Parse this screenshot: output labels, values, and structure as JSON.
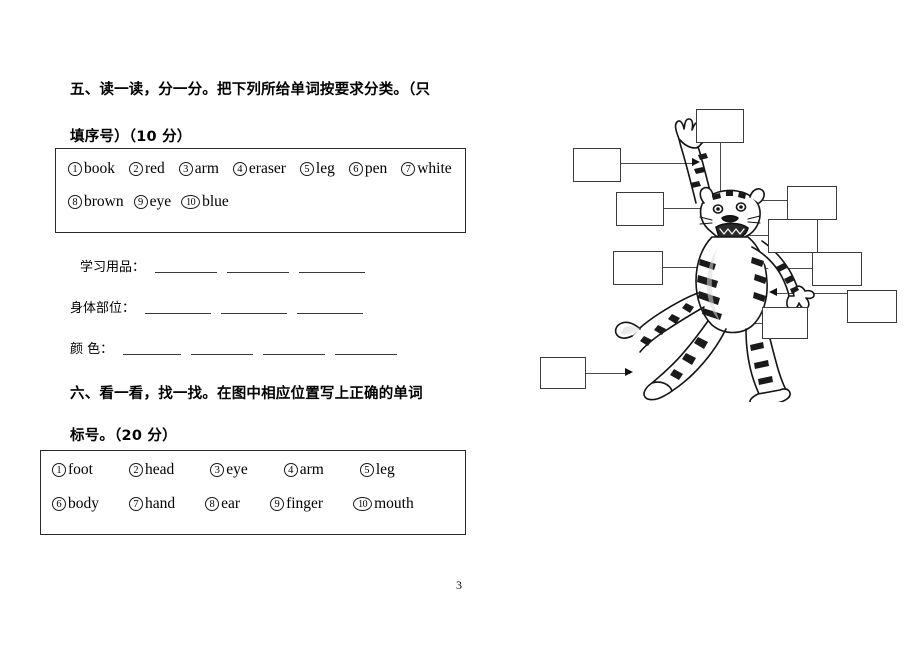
{
  "document": {
    "page_number": "3",
    "background_color": "#ffffff",
    "ink_color": "#000000"
  },
  "section_five": {
    "heading_line1": "五、读一读，分一分。把下列所给单词按要求分类。（只",
    "heading_line2": "填序号）（10 分）",
    "word_bank": {
      "row1": [
        {
          "num": "1",
          "word": "book"
        },
        {
          "num": "2",
          "word": "red"
        },
        {
          "num": "3",
          "word": "arm"
        },
        {
          "num": "4",
          "word": "eraser"
        },
        {
          "num": "5",
          "word": "leg"
        },
        {
          "num": "6",
          "word": "pen"
        },
        {
          "num": "7",
          "word": "white"
        }
      ],
      "row2": [
        {
          "num": "8",
          "word": "brown"
        },
        {
          "num": "9",
          "word": "eye"
        },
        {
          "num": "10",
          "word": "blue"
        }
      ]
    },
    "categories": [
      {
        "label": "学习用品：",
        "blanks": 3
      },
      {
        "label": "身体部位：",
        "blanks": 3
      },
      {
        "label": "颜    色：",
        "blanks": 4
      }
    ]
  },
  "section_six": {
    "heading_line1": "六、看一看，找一找。在图中相应位置写上正确的单词",
    "heading_line2": "标号。（20 分）",
    "word_bank": {
      "row1": [
        {
          "num": "1",
          "word": "foot"
        },
        {
          "num": "2",
          "word": "head"
        },
        {
          "num": "3",
          "word": "eye"
        },
        {
          "num": "4",
          "word": "arm"
        },
        {
          "num": "5",
          "word": "leg"
        }
      ],
      "row2": [
        {
          "num": "6",
          "word": "body"
        },
        {
          "num": "7",
          "word": "hand"
        },
        {
          "num": "8",
          "word": "ear"
        },
        {
          "num": "9",
          "word": "finger"
        },
        {
          "num": "10",
          "word": "mouth"
        }
      ]
    },
    "diagram": {
      "figure": "cartoon-tiger",
      "label_boxes": [
        {
          "id": "box-head-top",
          "value": ""
        },
        {
          "id": "box-hand-upper",
          "value": ""
        },
        {
          "id": "box-ear",
          "value": ""
        },
        {
          "id": "box-eye",
          "value": ""
        },
        {
          "id": "box-mouth",
          "value": ""
        },
        {
          "id": "box-body",
          "value": ""
        },
        {
          "id": "box-arm",
          "value": ""
        },
        {
          "id": "box-finger",
          "value": ""
        },
        {
          "id": "box-leg",
          "value": ""
        },
        {
          "id": "box-foot",
          "value": ""
        }
      ]
    }
  }
}
